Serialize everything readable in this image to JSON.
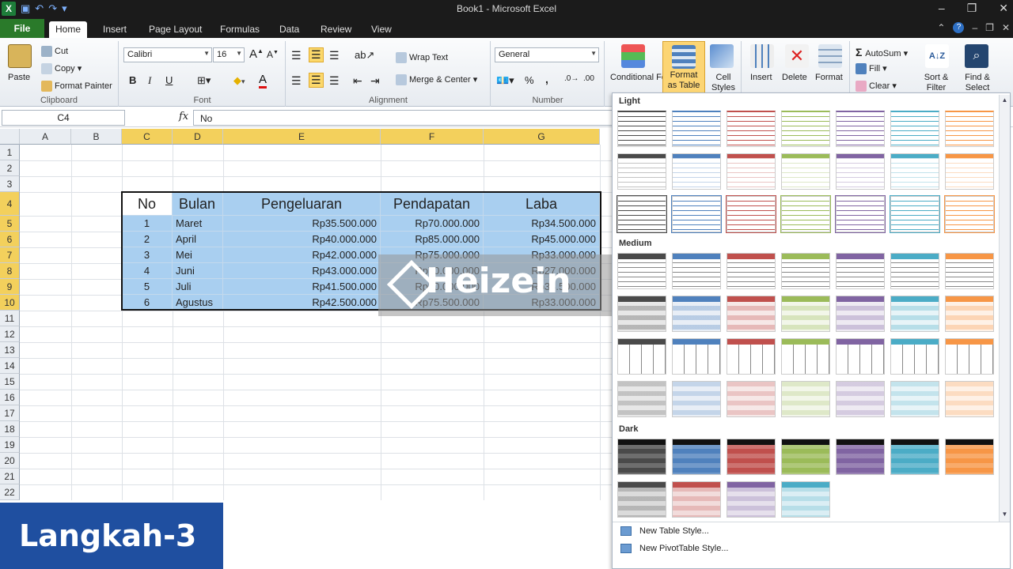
{
  "window": {
    "title": "Book1 - Microsoft Excel",
    "controls": [
      "–",
      "❐",
      "✕"
    ]
  },
  "tabs": {
    "file": "File",
    "items": [
      "Home",
      "Insert",
      "Page Layout",
      "Formulas",
      "Data",
      "Review",
      "View"
    ],
    "active": "Home"
  },
  "ribbon": {
    "clipboard": {
      "label": "Clipboard",
      "paste": "Paste",
      "cut": "Cut",
      "copy": "Copy",
      "format_painter": "Format Painter"
    },
    "font": {
      "label": "Font",
      "name": "Calibri",
      "size": "16",
      "bold": "B",
      "italic": "I",
      "underline": "U"
    },
    "alignment": {
      "label": "Alignment",
      "wrap": "Wrap Text",
      "merge": "Merge & Center"
    },
    "number": {
      "label": "Number",
      "format": "General",
      "percent": "%",
      "comma": ","
    },
    "styles": {
      "conditional": "Conditional Formatting",
      "format_table": "Format as Table",
      "cell_styles": "Cell Styles"
    },
    "cells": {
      "insert": "Insert",
      "delete": "Delete",
      "format": "Format"
    },
    "editing": {
      "autosum": "AutoSum",
      "fill": "Fill",
      "clear": "Clear",
      "sort": "Sort & Filter",
      "find": "Find & Select"
    }
  },
  "formula_bar": {
    "name_box": "C4",
    "fx": "fx",
    "content": "No"
  },
  "sheet": {
    "columns": [
      "A",
      "B",
      "C",
      "D",
      "E",
      "F",
      "G"
    ],
    "rows": [
      "1",
      "2",
      "3",
      "4",
      "5",
      "6",
      "7",
      "8",
      "9",
      "10",
      "11",
      "12",
      "13",
      "14",
      "15",
      "16",
      "17",
      "18",
      "19",
      "20",
      "21",
      "22"
    ],
    "table": {
      "headers": [
        "No",
        "Bulan",
        "Pengeluaran",
        "Pendapatan",
        "Laba"
      ],
      "rows": [
        [
          "1",
          "Maret",
          "Rp35.500.000",
          "Rp70.000.000",
          "Rp34.500.000"
        ],
        [
          "2",
          "April",
          "Rp40.000.000",
          "Rp85.000.000",
          "Rp45.000.000"
        ],
        [
          "3",
          "Mei",
          "Rp42.000.000",
          "Rp75.000.000",
          "Rp33.000.000"
        ],
        [
          "4",
          "Juni",
          "Rp43.000.000",
          "Rp70.000.000",
          "Rp27.000.000"
        ],
        [
          "5",
          "Juli",
          "Rp41.500.000",
          "Rp80.000.000",
          "Rp38.500.000"
        ],
        [
          "6",
          "Agustus",
          "Rp42.500.000",
          "Rp75.500.000",
          "Rp33.000.000"
        ]
      ]
    }
  },
  "gallery": {
    "sections": [
      "Light",
      "Medium",
      "Dark"
    ],
    "swatch_colors": [
      "#4a4a4a",
      "#4f81bd",
      "#c0504d",
      "#9bbb59",
      "#8064a2",
      "#4bacc6",
      "#f79646"
    ],
    "menu": [
      "New Table Style...",
      "New PivotTable Style..."
    ]
  },
  "watermark": "Heizein",
  "banner": "Langkah-3"
}
